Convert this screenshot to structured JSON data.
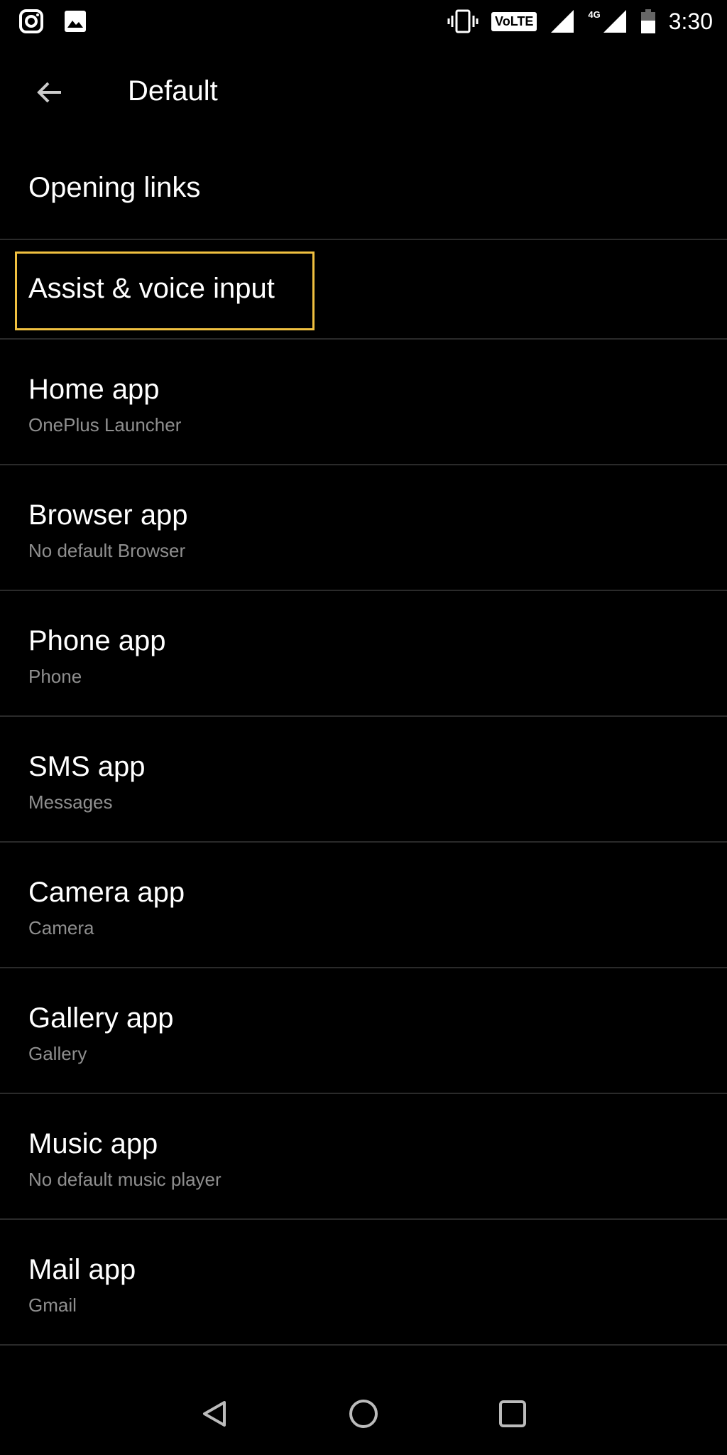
{
  "status_bar": {
    "time": "3:30",
    "volte": "VoLTE",
    "network": "4G",
    "icons": [
      "instagram-icon",
      "image-icon",
      "vibrate-icon",
      "volte-icon",
      "signal-icon",
      "signal-4g-icon",
      "battery-icon"
    ]
  },
  "header": {
    "title": "Default",
    "back_icon": "arrow-left-icon"
  },
  "items": [
    {
      "title": "Opening links",
      "subtitle": ""
    },
    {
      "title": "Assist & voice input",
      "subtitle": ""
    },
    {
      "title": "Home app",
      "subtitle": "OnePlus Launcher"
    },
    {
      "title": "Browser app",
      "subtitle": "No default Browser"
    },
    {
      "title": "Phone app",
      "subtitle": "Phone"
    },
    {
      "title": "SMS app",
      "subtitle": "Messages"
    },
    {
      "title": "Camera app",
      "subtitle": "Camera"
    },
    {
      "title": "Gallery app",
      "subtitle": "Gallery"
    },
    {
      "title": "Music app",
      "subtitle": "No default music player"
    },
    {
      "title": "Mail app",
      "subtitle": "Gmail"
    }
  ],
  "highlight_color": "#f0c040",
  "nav": [
    "back-icon",
    "home-icon",
    "recents-icon"
  ]
}
